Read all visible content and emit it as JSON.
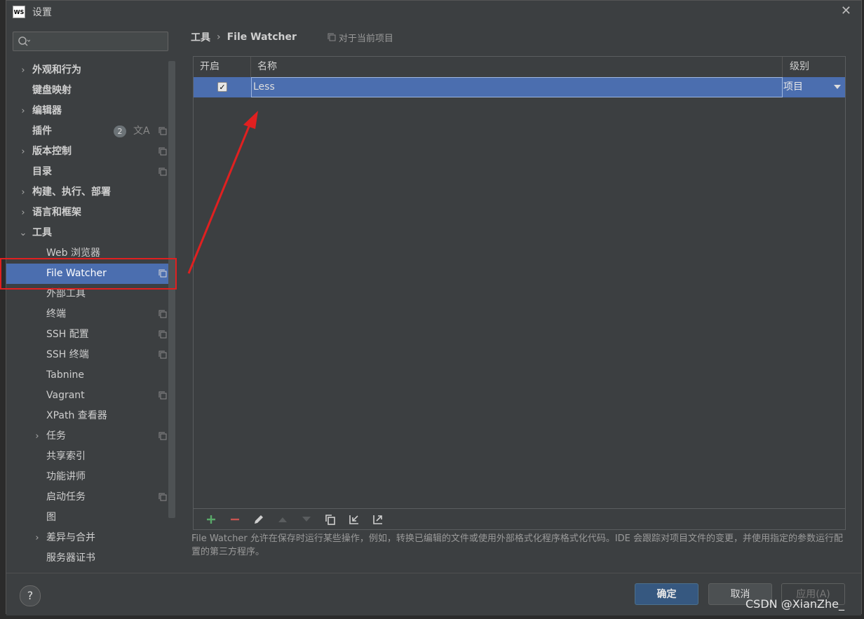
{
  "window": {
    "title": "设置",
    "logo_text": "WS"
  },
  "sidebar": {
    "items": [
      {
        "label": "外观和行为",
        "expand": "›"
      },
      {
        "label": "键盘映射"
      },
      {
        "label": "编辑器",
        "expand": "›"
      },
      {
        "label": "插件",
        "badge": "2"
      },
      {
        "label": "版本控制",
        "expand": "›"
      },
      {
        "label": "目录"
      },
      {
        "label": "构建、执行、部署",
        "expand": "›"
      },
      {
        "label": "语言和框架",
        "expand": "›"
      },
      {
        "label": "工具",
        "expand": "⌄"
      },
      {
        "label": "Web 浏览器"
      },
      {
        "label": "File Watcher"
      },
      {
        "label": "外部工具"
      },
      {
        "label": "终端"
      },
      {
        "label": "SSH 配置"
      },
      {
        "label": "SSH 终端"
      },
      {
        "label": "Tabnine"
      },
      {
        "label": "Vagrant"
      },
      {
        "label": "XPath 查看器"
      },
      {
        "label": "任务",
        "expand": "›"
      },
      {
        "label": "共享索引"
      },
      {
        "label": "功能讲师"
      },
      {
        "label": "启动任务"
      },
      {
        "label": "图"
      },
      {
        "label": "差异与合并",
        "expand": "›"
      },
      {
        "label": "服务器证书"
      }
    ]
  },
  "breadcrumb": {
    "parent": "工具",
    "current": "File Watcher",
    "scope_note": "对于当前项目"
  },
  "table": {
    "headers": [
      "开启",
      "名称",
      "级别"
    ],
    "rows": [
      {
        "enabled": "✓",
        "name": "Less",
        "level": "项目"
      }
    ]
  },
  "description": "File Watcher 允许在保存时运行某些操作，例如，转换已编辑的文件或使用外部格式化程序格式化代码。IDE 会跟踪对项目文件的变更，并使用指定的参数运行配置的第三方程序。",
  "footer": {
    "help": "?",
    "ok": "确定",
    "cancel": "取消",
    "apply": "应用(A)"
  },
  "watermark": "CSDN @XianZhe_",
  "colors": {
    "selection": "#4b6eaf",
    "annotation": "#e02020",
    "add": "#59a869",
    "remove": "#c75450"
  }
}
